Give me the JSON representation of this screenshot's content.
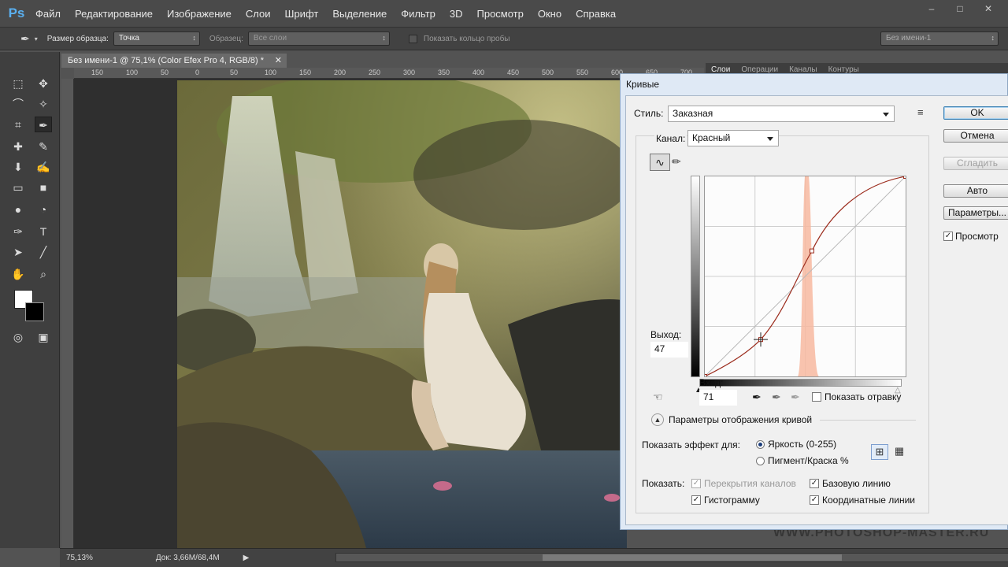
{
  "app": {
    "logo": "Ps",
    "menu": [
      "Файл",
      "Редактирование",
      "Изображение",
      "Слои",
      "Шрифт",
      "Выделение",
      "Фильтр",
      "3D",
      "Просмотр",
      "Окно",
      "Справка"
    ],
    "window_controls": [
      "–",
      "□",
      "✕"
    ]
  },
  "options": {
    "sample_size_label": "Размер образца:",
    "sample_size_value": "Точка",
    "sample_label": "Образец:",
    "sample_value": "Все слои",
    "show_ring_label": "Показать кольцо пробы",
    "workspace": "Без имени-1"
  },
  "document": {
    "tab_title": "Без имени-1 @ 75,1% (Color Efex Pro 4, RGB/8) *",
    "ruler_ticks": [
      "150",
      "100",
      "50",
      "0",
      "50",
      "100",
      "150",
      "200",
      "250",
      "300",
      "350",
      "400",
      "450",
      "500",
      "550",
      "600",
      "650",
      "700",
      "750"
    ]
  },
  "panels": {
    "tabs": [
      "Слои",
      "Операции",
      "Каналы",
      "Контуры"
    ]
  },
  "status": {
    "zoom": "75,13%",
    "doc": "Док: 3,66M/68,4M"
  },
  "watermark": "WWW.PHOTOSHOP-MASTER.RU",
  "curves": {
    "title": "Кривые",
    "style_label": "Стиль:",
    "style_value": "Заказная",
    "channel_label": "Канал:",
    "channel_value": "Красный",
    "output_label": "Выход:",
    "output_value": "47",
    "input_label": "Вход:",
    "input_value": "71",
    "show_clipping": "Показать отравку",
    "display_options": "Параметры отображения кривой",
    "show_effect_for": "Показать эффект для:",
    "radio_light": "Яркость (0-255)",
    "radio_pigment": "Пигмент/Краска %",
    "show_label": "Показать:",
    "cb_channel_overlays": "Перекрытия каналов",
    "cb_baseline": "Базовую линию",
    "cb_histogram": "Гистограмму",
    "cb_intersection": "Координатные линии",
    "buttons": {
      "ok": "OK",
      "cancel": "Отмена",
      "smooth": "Сгладить",
      "auto": "Авто",
      "params": "Параметры..."
    },
    "preview_label": "Просмотр",
    "curve_points": [
      [
        0,
        0
      ],
      [
        71,
        47
      ],
      [
        136,
        160
      ],
      [
        255,
        255
      ]
    ]
  }
}
